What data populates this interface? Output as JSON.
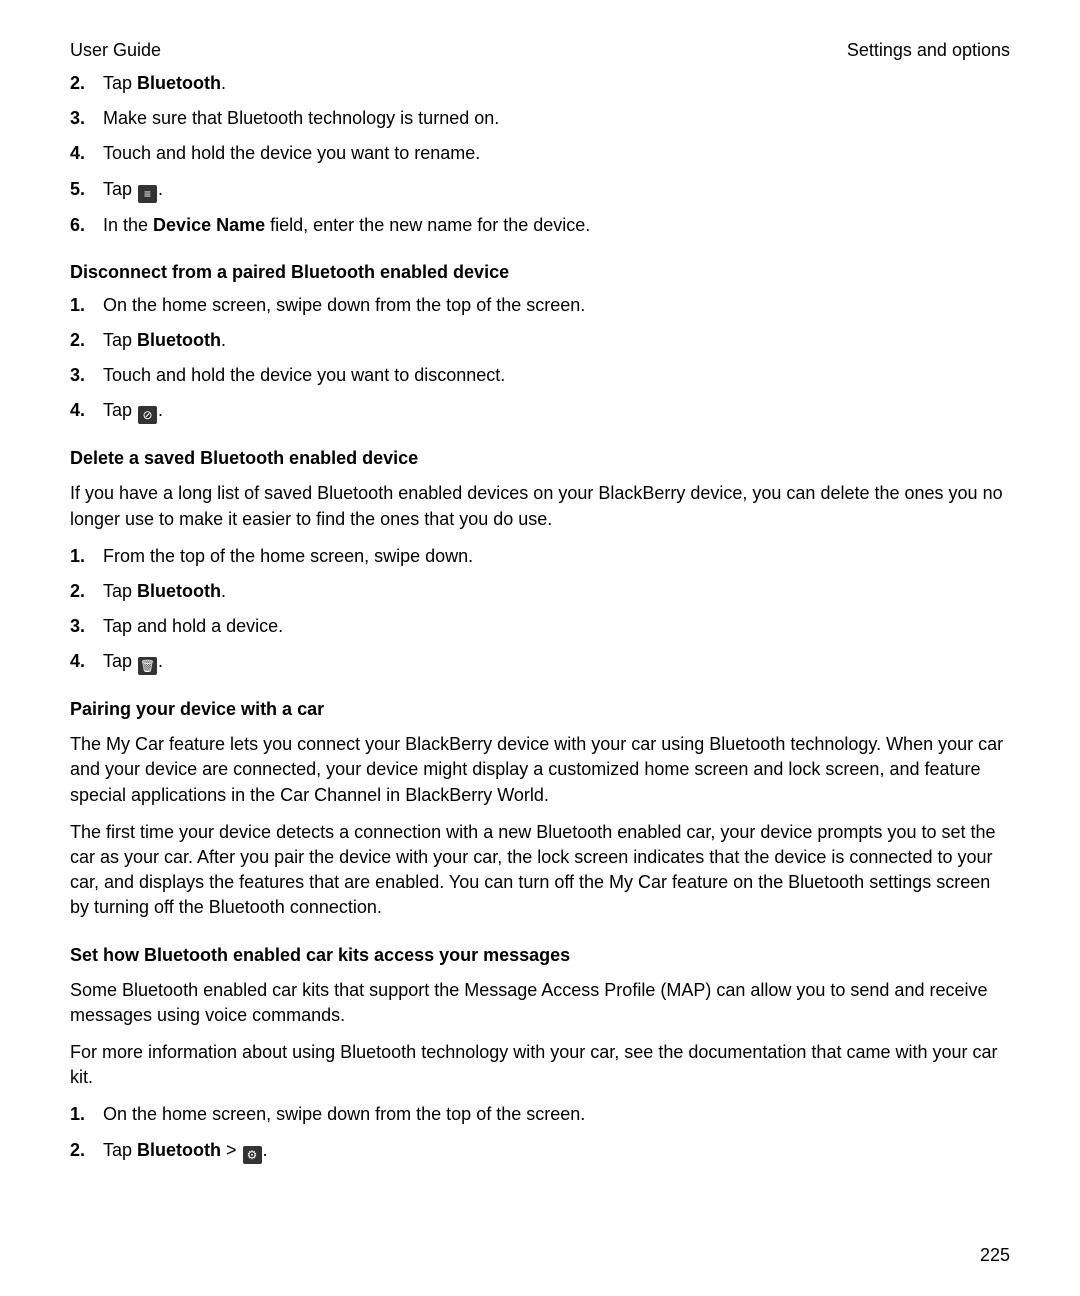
{
  "header": {
    "left": "User Guide",
    "right": "Settings and options"
  },
  "list1": {
    "items": {
      "2": {
        "pre": "Tap ",
        "b": "Bluetooth",
        "post": "."
      },
      "3": {
        "text": "Make sure that Bluetooth technology is turned on."
      },
      "4": {
        "text": "Touch and hold the device you want to rename."
      },
      "5": {
        "pre": "Tap ",
        "icon_name": "menu-icon",
        "icon_glyph": "≡",
        "post": "."
      },
      "6": {
        "pre": "In the ",
        "b": "Device Name",
        "post": " field, enter the new name for the device."
      }
    }
  },
  "section2": {
    "heading": "Disconnect from a paired Bluetooth enabled device",
    "items": {
      "1": {
        "text": "On the home screen, swipe down from the top of the screen."
      },
      "2": {
        "pre": "Tap ",
        "b": "Bluetooth",
        "post": "."
      },
      "3": {
        "text": "Touch and hold the device you want to disconnect."
      },
      "4": {
        "pre": "Tap ",
        "icon_name": "disconnect-icon",
        "icon_glyph": "⊘",
        "post": "."
      }
    }
  },
  "section3": {
    "heading": "Delete a saved Bluetooth enabled device",
    "para": "If you have a long list of saved Bluetooth enabled devices on your BlackBerry device, you can delete the ones you no longer use to make it easier to find the ones that you do use.",
    "items": {
      "1": {
        "text": "From the top of the home screen, swipe down."
      },
      "2": {
        "pre": "Tap ",
        "b": "Bluetooth",
        "post": "."
      },
      "3": {
        "text": "Tap and hold a device."
      },
      "4": {
        "pre": "Tap ",
        "icon_name": "trash-icon",
        "icon_glyph": "🗑",
        "post": "."
      }
    }
  },
  "section4": {
    "heading": "Pairing your device with a car",
    "para1": "The My Car feature lets you connect your BlackBerry device with your car using Bluetooth technology. When your car and your device are connected, your device might display a customized home screen and lock screen, and feature special applications in the Car Channel in BlackBerry World.",
    "para2": "The first time your device detects a connection with a new Bluetooth enabled car, your device prompts you to set the car as your car. After you pair the device with your car, the lock screen indicates that the device is connected to your car, and displays the features that are enabled. You can turn off the My Car feature on the Bluetooth settings screen by turning off the Bluetooth connection."
  },
  "section5": {
    "heading": "Set how Bluetooth enabled car kits access your messages",
    "para1": "Some Bluetooth enabled car kits that support the Message Access Profile (MAP) can allow you to send and receive messages using voice commands.",
    "para2": "For more information about using Bluetooth technology with your car, see the documentation that came with your car kit.",
    "items": {
      "1": {
        "text": "On the home screen, swipe down from the top of the screen."
      },
      "2": {
        "pre": "Tap ",
        "b": "Bluetooth",
        "mid": " > ",
        "icon_name": "settings-icon",
        "icon_glyph": "⚙",
        "post": "."
      }
    }
  },
  "page_number": "225"
}
